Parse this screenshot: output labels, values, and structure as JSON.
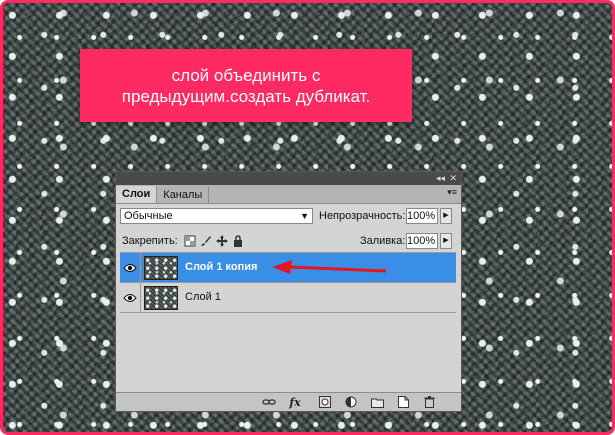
{
  "annotation": {
    "line1": "слой объединить с",
    "line2": "предыдущим.создать дубликат."
  },
  "panel": {
    "titlebar": {
      "collapse_glyph": "◂◂",
      "close_glyph": "✕"
    },
    "tabs": [
      {
        "label": "Слои",
        "active": true
      },
      {
        "label": "Каналы",
        "active": false
      }
    ],
    "menu_glyph": "▾≡",
    "blend_mode": "Обычные",
    "opacity_label": "Непрозрачность:",
    "opacity_value": "100%",
    "lock_label": "Закрепить:",
    "fill_label": "Заливка:",
    "fill_value": "100%",
    "layers": [
      {
        "name": "Слой 1 копия",
        "selected": true
      },
      {
        "name": "Слой 1",
        "selected": false
      }
    ],
    "bottom_icons": [
      "link-icon",
      "fx-icon",
      "mask-icon",
      "adjustment-icon",
      "folder-icon",
      "new-layer-icon",
      "trash-icon"
    ],
    "fx_label": "fx"
  },
  "colors": {
    "frame_border": "#ff2a62",
    "note_background": "#ff2a62",
    "selection": "#3a8ee6",
    "arrow": "#e8141e"
  }
}
